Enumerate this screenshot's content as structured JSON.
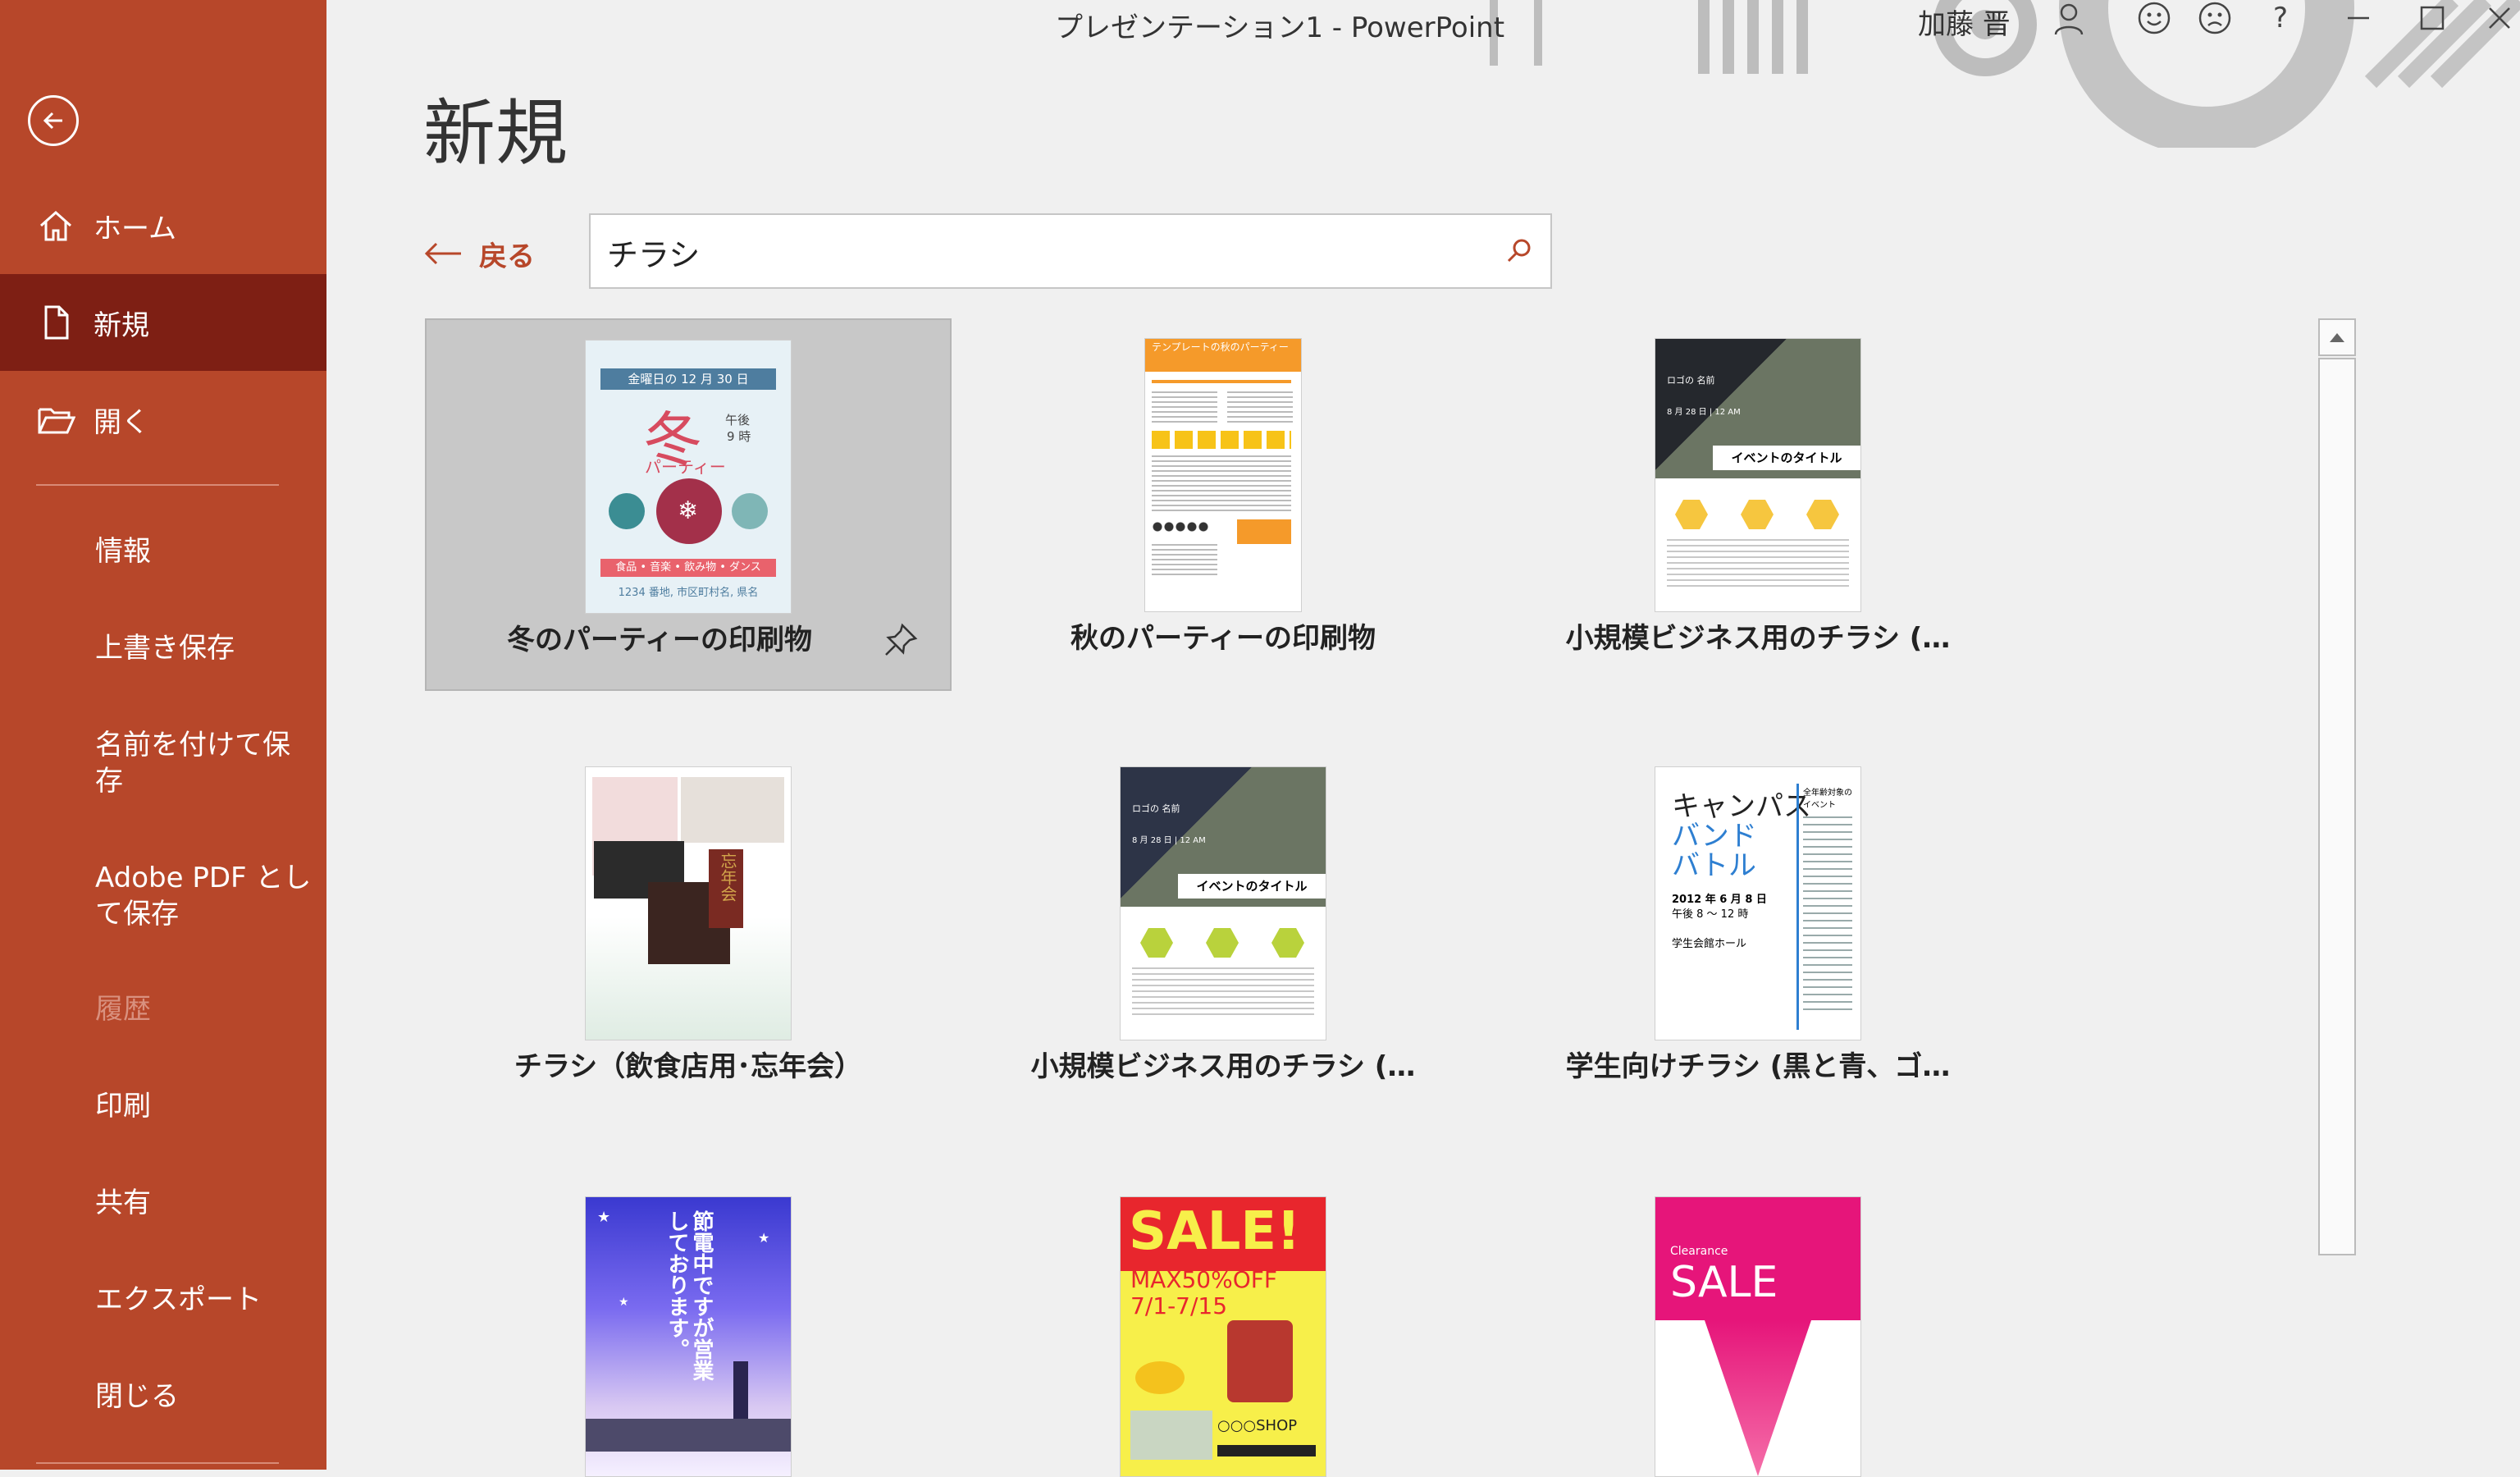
{
  "window": {
    "title": "プレゼンテーション1  -  PowerPoint",
    "user": "加藤 晋",
    "help_label": "?"
  },
  "sidebar": {
    "items": [
      {
        "label": "ホーム"
      },
      {
        "label": "新規"
      },
      {
        "label": "開く"
      }
    ],
    "sub_items": [
      {
        "label": "情報"
      },
      {
        "label": "上書き保存"
      },
      {
        "label": "名前を付けて保存"
      },
      {
        "label": "Adobe PDF として保存"
      },
      {
        "label": "履歴"
      },
      {
        "label": "印刷"
      },
      {
        "label": "共有"
      },
      {
        "label": "エクスポート"
      },
      {
        "label": "閉じる"
      }
    ]
  },
  "main": {
    "title": "新規",
    "back_label": "戻る",
    "search": {
      "value": "チラシ"
    },
    "templates": [
      {
        "name": "冬のパーティーの印刷物"
      },
      {
        "name": "秋のパーティーの印刷物"
      },
      {
        "name": "小規模ビジネス用のチラシ (…"
      },
      {
        "name": "チラシ（飲食店用･忘年会）"
      },
      {
        "name": "小規模ビジネス用のチラシ (…"
      },
      {
        "name": "学生向けチラシ (黒と青、ゴ…"
      }
    ]
  },
  "thumbnails": {
    "winter": {
      "date": "金曜日の 12 月 30 日",
      "kanji": "冬",
      "party": "パーティー",
      "time1": "午後",
      "time2": "9 時",
      "strip": "食品 • 音楽 • 飲み物 • ダンス",
      "address": "1234 番地, 市区町村名, 県名"
    },
    "autumn": {
      "header": "テンプレートの秋のパーティー"
    },
    "business": {
      "logo": "ロゴの 名前",
      "headline": "イベントのタイトル",
      "date": "8 月 28 日 | 12 AM"
    },
    "restaurant": {
      "title": "忘年会"
    },
    "student": {
      "title": "キャンパス",
      "title2": "バンド",
      "title3": "バトル",
      "year": "2012 年 6 月 8 日",
      "time": "午後 8 〜 12 時",
      "place": "学生会館ホール",
      "side": "全年齢対象の イベント"
    },
    "energy": {
      "text": "節電中ですが営業しております。"
    },
    "sale": {
      "headline": "SALE!",
      "sub1": "MAX50%OFF",
      "sub2": "7/1-7/15",
      "shop": "○○○SHOP"
    },
    "clearance": {
      "small": "Clearance",
      "big": "SALE"
    }
  },
  "colors": {
    "accent": "#b7472a",
    "accent_dark": "#7e1f14"
  }
}
